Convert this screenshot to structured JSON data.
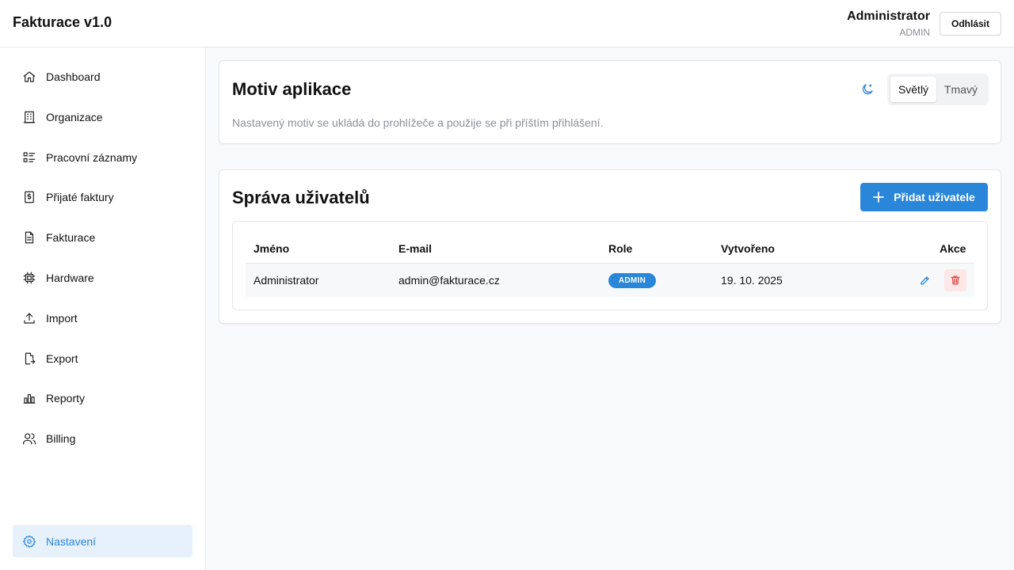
{
  "header": {
    "app_title": "Fakturace v1.0",
    "user_name": "Administrator",
    "user_role": "ADMIN",
    "logout_label": "Odhlásit"
  },
  "sidebar": {
    "items": [
      {
        "label": "Dashboard",
        "icon": "home-icon"
      },
      {
        "label": "Organizace",
        "icon": "building-icon"
      },
      {
        "label": "Pracovní záznamy",
        "icon": "list-icon"
      },
      {
        "label": "Přijaté faktury",
        "icon": "receipt-icon"
      },
      {
        "label": "Fakturace",
        "icon": "file-icon"
      },
      {
        "label": "Hardware",
        "icon": "chip-icon"
      },
      {
        "label": "Import",
        "icon": "upload-icon"
      },
      {
        "label": "Export",
        "icon": "file-export-icon"
      },
      {
        "label": "Reporty",
        "icon": "bar-chart-icon"
      },
      {
        "label": "Billing",
        "icon": "users-icon"
      }
    ],
    "settings": {
      "label": "Nastavení",
      "icon": "gear-icon",
      "active": true
    }
  },
  "theme": {
    "title": "Motiv aplikace",
    "description": "Nastavený motiv se ukládá do prohlížeče a použije se při příštím přihlášení.",
    "light_label": "Světlý",
    "dark_label": "Tmavý",
    "selected": "Světlý"
  },
  "users": {
    "title": "Správa uživatelů",
    "add_label": "Přidat uživatele",
    "columns": [
      "Jméno",
      "E-mail",
      "Role",
      "Vytvořeno",
      "Akce"
    ],
    "rows": [
      {
        "name": "Administrator",
        "email": "admin@fakturace.cz",
        "role": "ADMIN",
        "created": "19. 10. 2025"
      }
    ]
  },
  "colors": {
    "accent": "#2a86d8",
    "active_nav_bg": "#e6f1fb",
    "danger": "#e35050",
    "danger_bg": "#fde7e7"
  }
}
